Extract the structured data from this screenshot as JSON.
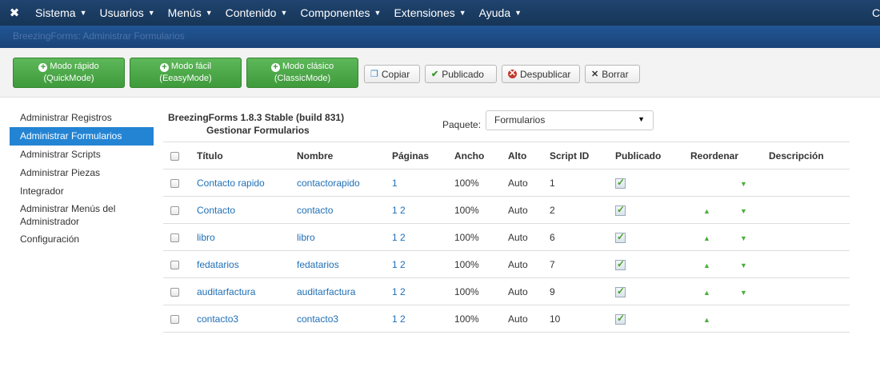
{
  "topbar": {
    "logo": "joomla-logo",
    "menus": [
      {
        "label": "Sistema"
      },
      {
        "label": "Usuarios"
      },
      {
        "label": "Menús"
      },
      {
        "label": "Contenido"
      },
      {
        "label": "Componentes"
      },
      {
        "label": "Extensiones"
      },
      {
        "label": "Ayuda"
      }
    ],
    "right_text": "C"
  },
  "titlebar": {
    "title": "BreezingForms: Administrar Formularios"
  },
  "toolbar": {
    "quick": {
      "line1": "Modo rápido",
      "line2": "(QuickMode)"
    },
    "easy": {
      "line1": "Modo fácil",
      "line2": "(EeasyMode)"
    },
    "classic": {
      "line1": "Modo clásico",
      "line2": "(ClassicMode)"
    },
    "copy": "Copiar",
    "publish": "Publicado",
    "unpublish": "Despublicar",
    "delete": "Borrar"
  },
  "sidebar": {
    "items": [
      {
        "label": "Administrar Registros"
      },
      {
        "label": "Administrar Formularios"
      },
      {
        "label": "Administrar Scripts"
      },
      {
        "label": "Administrar Piezas"
      },
      {
        "label": "Integrador"
      },
      {
        "label": "Administrar Menús del Administrador"
      },
      {
        "label": "Configuración"
      }
    ]
  },
  "main": {
    "version": "BreezingForms 1.8.3 Stable (build 831)",
    "subtitle": "Gestionar Formularios",
    "package_label": "Paquete:",
    "package_value": "Formularios",
    "columns": [
      "Título",
      "Nombre",
      "Páginas",
      "Ancho",
      "Alto",
      "Script ID",
      "Publicado",
      "Reordenar",
      "Descripción"
    ],
    "rows": [
      {
        "title": "Contacto rapido",
        "name": "contactorapido",
        "pages": "1",
        "width": "100%",
        "height": "Auto",
        "script_id": "1",
        "published": true,
        "up": false,
        "down": true,
        "description": ""
      },
      {
        "title": "Contacto",
        "name": "contacto",
        "pages": "1 2",
        "width": "100%",
        "height": "Auto",
        "script_id": "2",
        "published": true,
        "up": true,
        "down": true,
        "description": ""
      },
      {
        "title": "libro",
        "name": "libro",
        "pages": "1 2",
        "width": "100%",
        "height": "Auto",
        "script_id": "6",
        "published": true,
        "up": true,
        "down": true,
        "description": ""
      },
      {
        "title": "fedatarios",
        "name": "fedatarios",
        "pages": "1 2",
        "width": "100%",
        "height": "Auto",
        "script_id": "7",
        "published": true,
        "up": true,
        "down": true,
        "description": ""
      },
      {
        "title": "auditarfactura",
        "name": "auditarfactura",
        "pages": "1 2",
        "width": "100%",
        "height": "Auto",
        "script_id": "9",
        "published": true,
        "up": true,
        "down": true,
        "description": ""
      },
      {
        "title": "contacto3",
        "name": "contacto3",
        "pages": "1 2",
        "width": "100%",
        "height": "Auto",
        "script_id": "10",
        "published": true,
        "up": true,
        "down": false,
        "description": ""
      }
    ]
  }
}
